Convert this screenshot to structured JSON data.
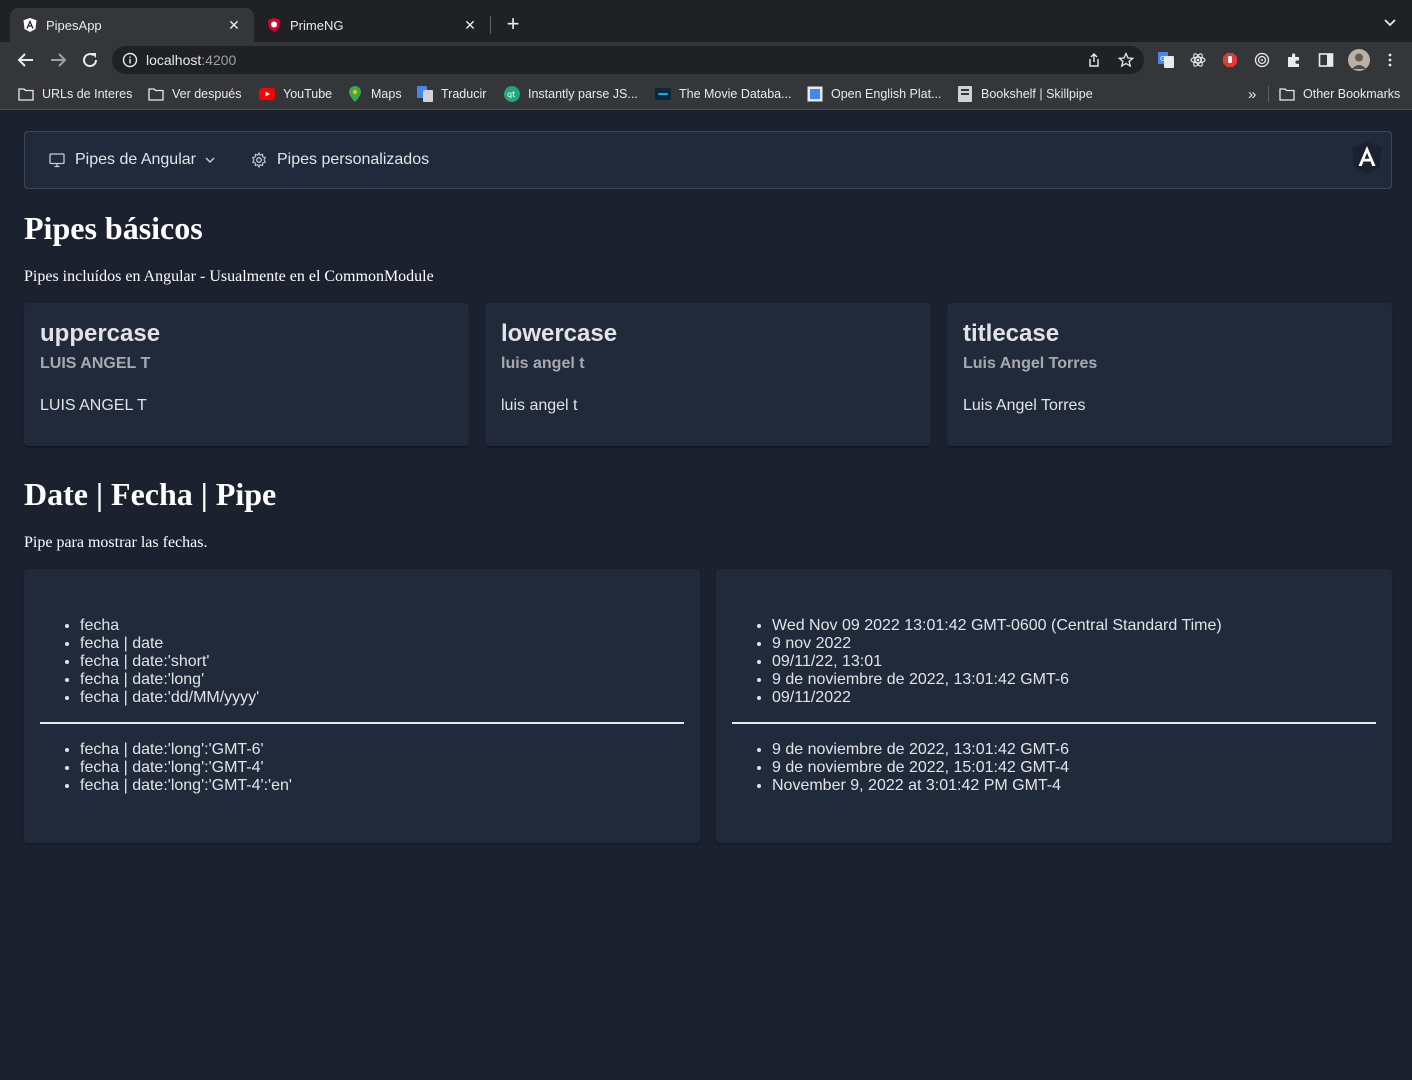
{
  "browser": {
    "tabs": [
      {
        "title": "PipesApp",
        "active": true
      },
      {
        "title": "PrimeNG",
        "active": false
      }
    ],
    "url": {
      "host": "localhost",
      "port": ":4200"
    },
    "bookmarks": [
      {
        "label": "URLs de Interes",
        "icon": "folder-icon"
      },
      {
        "label": "Ver después",
        "icon": "folder-icon"
      },
      {
        "label": "YouTube",
        "icon": "youtube-icon"
      },
      {
        "label": "Maps",
        "icon": "maps-icon"
      },
      {
        "label": "Traducir",
        "icon": "translate-icon"
      },
      {
        "label": "Instantly parse JS...",
        "icon": "qt-icon"
      },
      {
        "label": "The Movie Databa...",
        "icon": "tmdb-icon"
      },
      {
        "label": "Open English Plat...",
        "icon": "page-icon"
      },
      {
        "label": "Bookshelf | Skillpipe",
        "icon": "book-icon"
      }
    ],
    "overflow_label": "»",
    "other_bookmarks": "Other Bookmarks"
  },
  "menubar": {
    "items": [
      {
        "label": "Pipes de Angular",
        "icon": "desktop-icon",
        "has_submenu": true
      },
      {
        "label": "Pipes personalizados",
        "icon": "gear-icon",
        "has_submenu": false
      }
    ]
  },
  "basic": {
    "title": "Pipes básicos",
    "description": "Pipes incluídos en Angular - Usualmente en el CommonModule",
    "cards": [
      {
        "title": "uppercase",
        "subtitle": "LUIS ANGEL T",
        "content": "LUIS ANGEL T"
      },
      {
        "title": "lowercase",
        "subtitle": "luis angel t",
        "content": "luis angel t"
      },
      {
        "title": "titlecase",
        "subtitle": "Luis Angel Torres",
        "content": "Luis Angel Torres"
      }
    ]
  },
  "date": {
    "title": "Date | Fecha | Pipe",
    "description": "Pipe para mostrar las fechas.",
    "left": {
      "list1": [
        "fecha",
        "fecha | date",
        "fecha | date:'short'",
        "fecha | date:'long'",
        "fecha | date:'dd/MM/yyyy'"
      ],
      "list2": [
        "fecha | date:'long':'GMT-6'",
        "fecha | date:'long':'GMT-4'",
        "fecha | date:'long':'GMT-4':'en'"
      ]
    },
    "right": {
      "list1": [
        "Wed Nov 09 2022 13:01:42 GMT-0600 (Central Standard Time)",
        "9 nov 2022",
        "09/11/22, 13:01",
        "9 de noviembre de 2022, 13:01:42 GMT-6",
        "09/11/2022"
      ],
      "list2": [
        "9 de noviembre de 2022, 13:01:42 GMT-6",
        "9 de noviembre de 2022, 15:01:42 GMT-4",
        "November 9, 2022 at 3:01:42 PM GMT-4"
      ]
    }
  },
  "colors": {
    "page_bg": "#1c2130",
    "card_bg": "#212a3b",
    "chrome_dark": "#202124",
    "chrome_light": "#35363a"
  }
}
